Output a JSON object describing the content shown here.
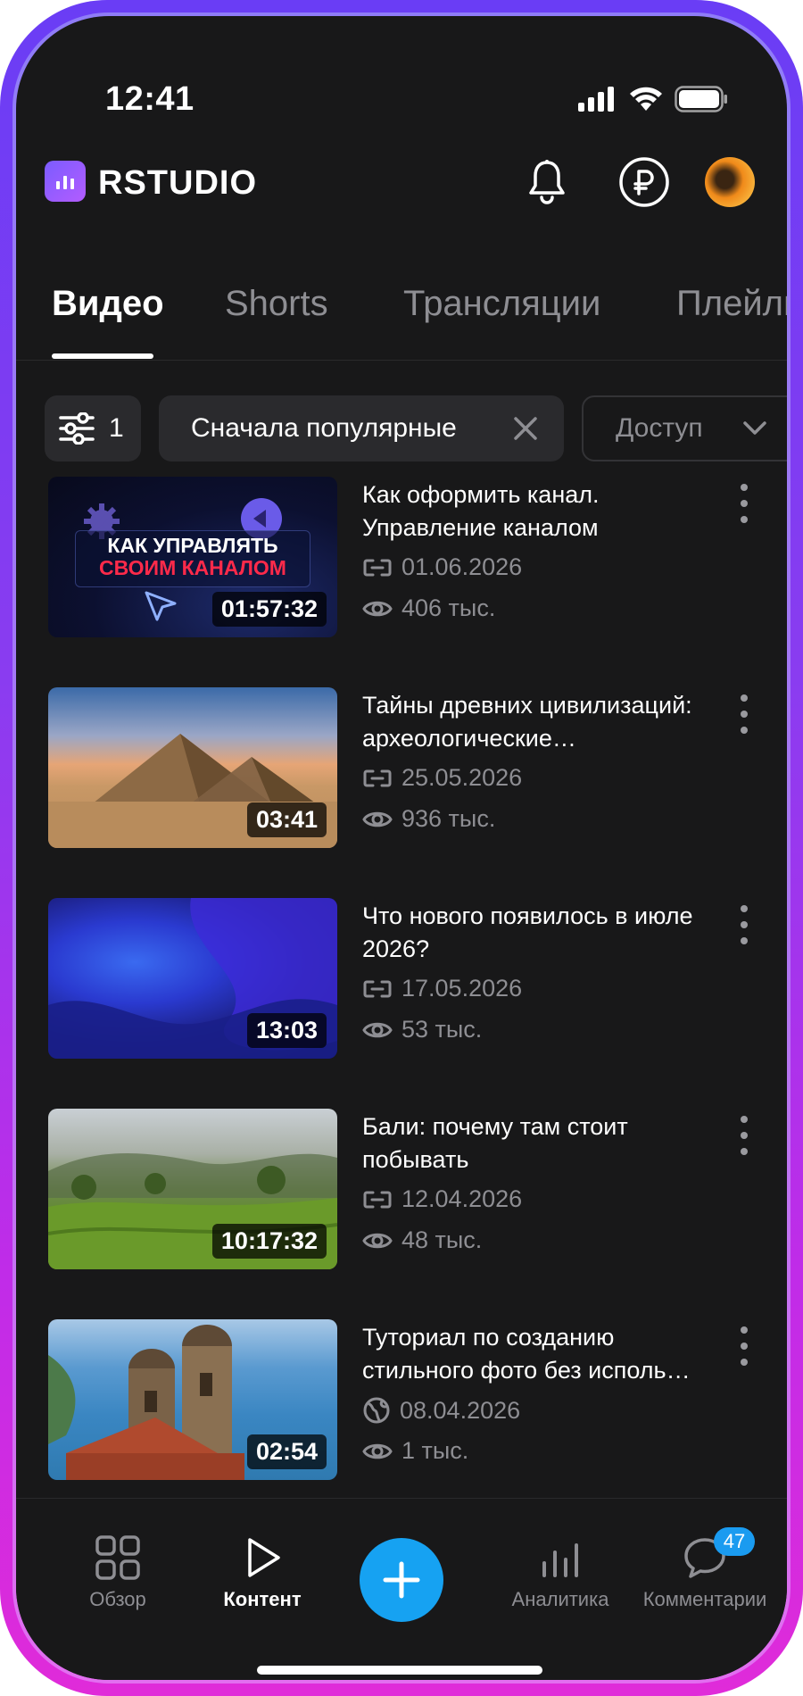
{
  "status_bar": {
    "time": "12:41"
  },
  "header": {
    "logo_text": "RSTUDIO"
  },
  "tabs": [
    {
      "label": "Видео",
      "active": true
    },
    {
      "label": "Shorts",
      "active": false
    },
    {
      "label": "Трансляции",
      "active": false
    },
    {
      "label": "Плейлисты",
      "active": false
    }
  ],
  "filters": {
    "filter_count": "1",
    "sort_label": "Сначала популярные",
    "access_label": "Доступ"
  },
  "videos": [
    {
      "title": "Как оформить канал. Управление каналом",
      "date": "01.06.2026",
      "views": "406 тыс.",
      "duration": "01:57:32",
      "visibility_icon": "link-icon",
      "thumb_text_1": "КАК УПРАВЛЯТЬ",
      "thumb_text_2": "СВОИМ КАНАЛОМ"
    },
    {
      "title": "Тайны древних цивилизаций: археологические…",
      "date": "25.05.2026",
      "views": "936 тыс.",
      "duration": "03:41",
      "visibility_icon": "link-icon"
    },
    {
      "title": "Что нового появилось в июле 2026?",
      "date": "17.05.2026",
      "views": "53 тыс.",
      "duration": "13:03",
      "visibility_icon": "link-icon"
    },
    {
      "title": "Бали: почему там стоит побывать",
      "date": "12.04.2026",
      "views": "48 тыс.",
      "duration": "10:17:32",
      "visibility_icon": "link-icon"
    },
    {
      "title": "Туториал по созданию стильного фото без исполь…",
      "date": "08.04.2026",
      "views": "1 тыс.",
      "duration": "02:54",
      "visibility_icon": "globe-icon"
    }
  ],
  "bottom_nav": {
    "overview": "Обзор",
    "content": "Контент",
    "analytics": "Аналитика",
    "comments": "Комментарии",
    "comments_badge": "47"
  },
  "colors": {
    "accent": "#16a2f2",
    "background": "#181819",
    "frame": "#8a3cf0"
  }
}
